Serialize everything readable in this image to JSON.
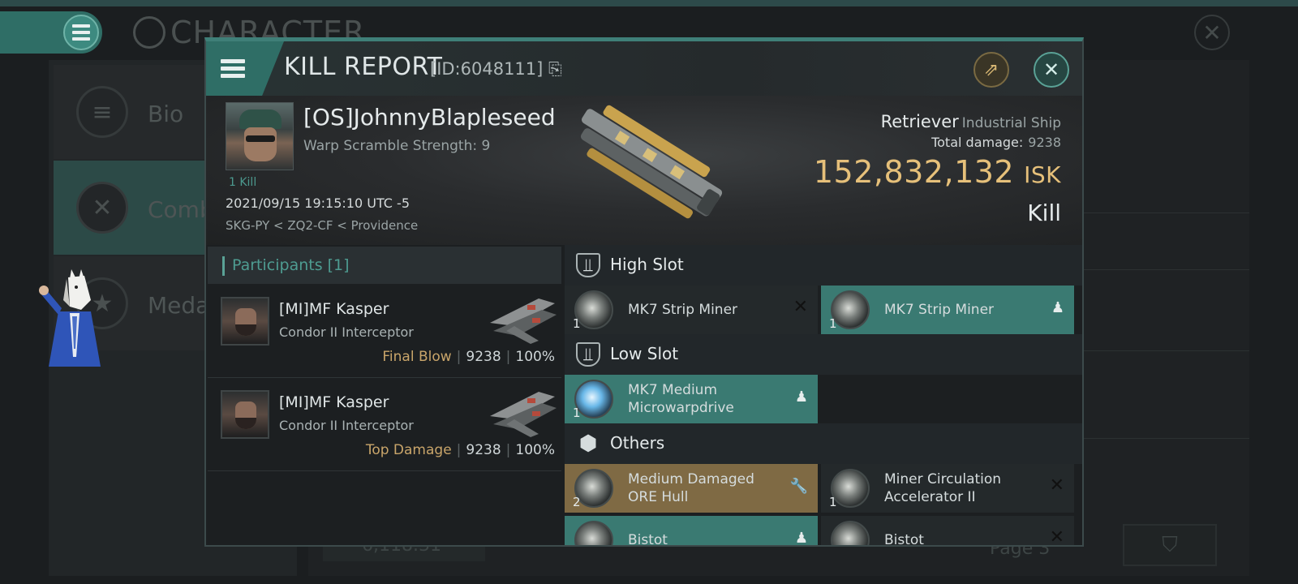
{
  "background": {
    "title": "CHARACTER",
    "tabs": [
      {
        "label": "Bio"
      },
      {
        "label": "Comba"
      },
      {
        "label": "Medal"
      }
    ],
    "bottom_value": "6,118.31",
    "page_label": "Page 3"
  },
  "modal": {
    "title": "KILL REPORT",
    "id_label": "[ID:6048111]",
    "victim": {
      "name": "[OS]JohnnyBlapleseed",
      "warp": "Warp Scramble Strength: 9",
      "kills": "1 Kill",
      "datetime": "2021/09/15 19:15:10 UTC -5",
      "location": "SKG-PY < ZQ2-CF < Providence"
    },
    "ship": {
      "name": "Retriever",
      "class": "Industrial Ship",
      "total_damage_label": "Total damage:",
      "total_damage": "9238",
      "isk_value": "152,832,132",
      "isk_unit": "ISK",
      "result": "Kill"
    },
    "participants": {
      "header": "Participants [1]",
      "rows": [
        {
          "name": "[MI]MF Kasper",
          "ship": "Condor II Interceptor",
          "tag": "Final Blow",
          "damage": "9238",
          "percent": "100%"
        },
        {
          "name": "[MI]MF Kasper",
          "ship": "Condor II Interceptor",
          "tag": "Top Damage",
          "damage": "9238",
          "percent": "100%"
        }
      ]
    },
    "slots": {
      "high_label": "High Slot",
      "low_label": "Low Slot",
      "others_label": "Others",
      "high": [
        {
          "qty": "1",
          "name": "MK7 Strip Miner",
          "state": "destroyed"
        },
        {
          "qty": "1",
          "name": "MK7 Strip Miner",
          "state": "dropped"
        }
      ],
      "low": [
        {
          "qty": "1",
          "name": "MK7 Medium Microwarpdrive",
          "state": "dropped"
        }
      ],
      "others": [
        {
          "qty": "2",
          "name": "Medium Damaged ORE Hull",
          "state": "salvage"
        },
        {
          "qty": "1",
          "name": "Miner Circulation Accelerator II",
          "state": "destroyed"
        },
        {
          "qty": "",
          "name": "Bistot",
          "state": "dropped"
        },
        {
          "qty": "",
          "name": "Bistot",
          "state": "destroyed"
        }
      ]
    }
  },
  "colors": {
    "accent": "#3f7f78",
    "isk": "#e6c07a",
    "dropped": "#3a7a72",
    "salvage": "#7f6a44"
  }
}
